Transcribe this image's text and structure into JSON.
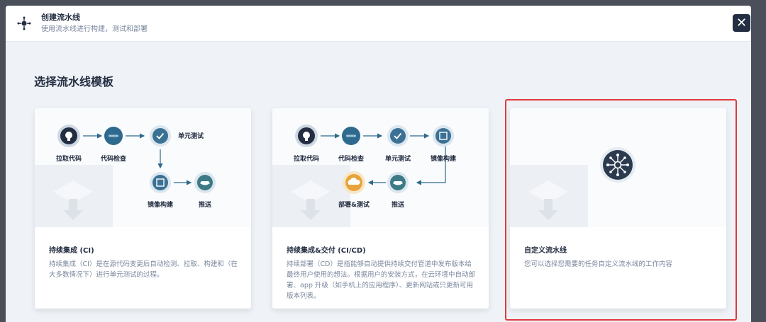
{
  "modal": {
    "title": "创建流水线",
    "subtitle": "使用流水线进行构建，测试和部署",
    "close_icon": "close-icon",
    "header_icon": "pipeline-icon"
  },
  "section_title": "选择流水线模板",
  "templates": [
    {
      "title": "持续集成 (CI)",
      "description": "持续集成（CI）是在源代码变更后自动检测、拉取、构建和（在大多数情况下）进行单元测试的过程。",
      "steps": [
        "拉取代码",
        "代码检查",
        "单元测试",
        "镜像构建",
        "推送"
      ]
    },
    {
      "title": "持续集成&交付 (CI/CD)",
      "description": "持续部署（CD）是指能够自动提供持续交付管道中发布版本给最终用户使用的想法。根据用户的安装方式，在云环境中自动部署、app 升级（如手机上的应用程序）、更新网站或只更新可用版本列表。",
      "steps": [
        "拉取代码",
        "代码检查",
        "单元测试",
        "镜像构建",
        "推送",
        "部署&测试"
      ]
    },
    {
      "title": "自定义流水线",
      "description": "您可以选择您需要的任务自定义流水线的工作内容",
      "icon": "custom-pipeline-icon"
    }
  ],
  "colors": {
    "accent": "#242e42",
    "highlight": "#e0393e",
    "node_blue": "#2e6a8e",
    "node_teal": "#3c7a86",
    "node_orange": "#e8a43a"
  }
}
